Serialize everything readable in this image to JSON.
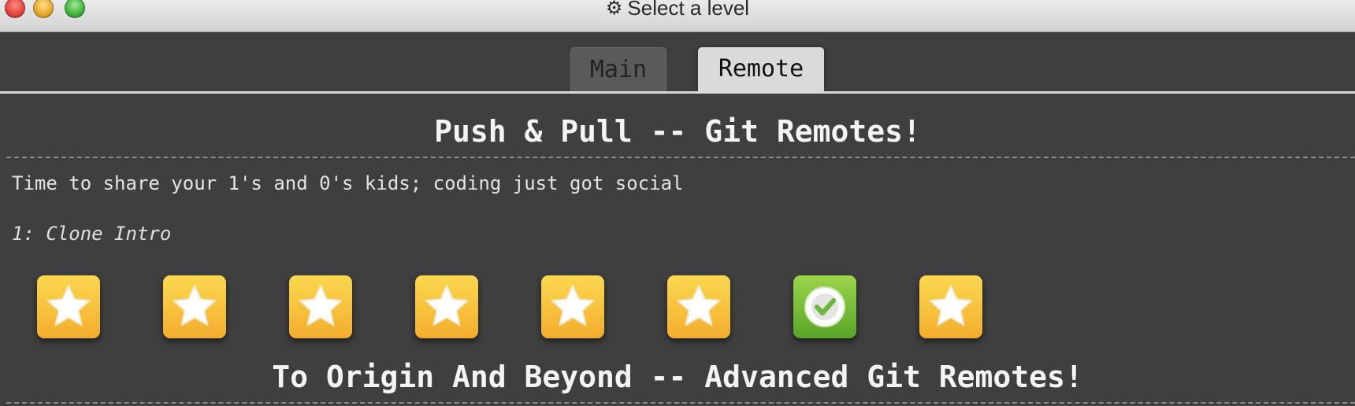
{
  "window": {
    "title": "Select a level",
    "title_icon": "gear-icon",
    "buttons": [
      "close",
      "minimize",
      "maximize"
    ]
  },
  "tabs": [
    {
      "label": "Main",
      "active": false
    },
    {
      "label": "Remote",
      "active": true
    }
  ],
  "sections": [
    {
      "title": "Push & Pull -- Git Remotes!",
      "description": "Time to share your 1's and 0's kids; coding just got social",
      "current_level_label": "1: Clone Intro",
      "levels": [
        {
          "status": "star"
        },
        {
          "status": "star"
        },
        {
          "status": "star"
        },
        {
          "status": "star"
        },
        {
          "status": "star"
        },
        {
          "status": "star"
        },
        {
          "status": "completed"
        },
        {
          "status": "star"
        }
      ]
    },
    {
      "title": "To Origin And Beyond -- Advanced Git Remotes!"
    }
  ],
  "colors": {
    "star_tile_top": "#fbd84f",
    "star_tile_bottom": "#f4ad2e",
    "done_tile_top": "#9bd54a",
    "done_tile_bottom": "#58a528",
    "background": "#3f3f3f"
  }
}
